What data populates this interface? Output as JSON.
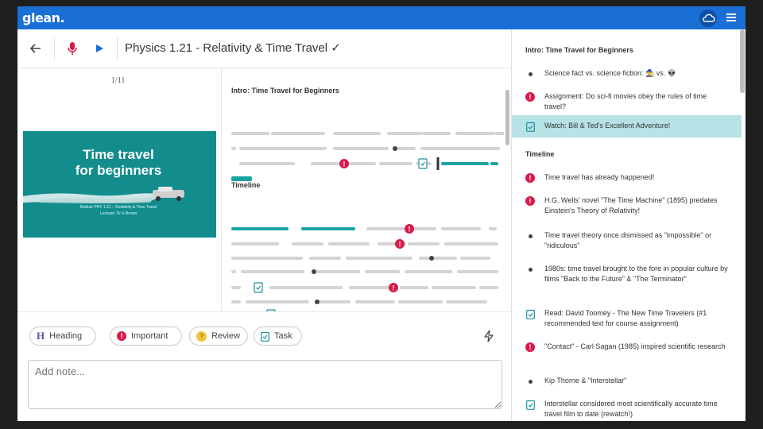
{
  "app": {
    "logo": "glean."
  },
  "header": {
    "title": "Physics 1.21 - Relativity & Time Travel ✓"
  },
  "slide": {
    "page_indicator": "1/11",
    "title_line1": "Time travel",
    "title_line2": "for beginners",
    "subtitle": "Module PHY 1.21 – Relativity & Time Travel",
    "lecturer": "Lecturer: Dr E Brown"
  },
  "outline": {
    "sections": [
      "Intro: Time Travel for Beginners",
      "Timeline"
    ]
  },
  "toolbar": {
    "tags": [
      {
        "label": "Heading",
        "icon": "heading-icon"
      },
      {
        "label": "Important",
        "icon": "important-icon"
      },
      {
        "label": "Review",
        "icon": "review-icon"
      },
      {
        "label": "Task",
        "icon": "task-icon"
      }
    ],
    "note_placeholder": "Add note..."
  },
  "notes": {
    "sections": [
      "Intro: Time Travel for Beginners",
      "Timeline"
    ],
    "intro_items": [
      {
        "type": "bullet",
        "text": "Science fact vs. science fiction: 🧙 vs. 👽"
      },
      {
        "type": "important",
        "text": "Assignment: Do sci-fi movies obey the rules of time travel?"
      },
      {
        "type": "task",
        "text": "Watch: Bill & Ted's Excellent Adventure!"
      }
    ],
    "timeline_items": [
      {
        "type": "important",
        "text": "Time travel has already happened!"
      },
      {
        "type": "important",
        "text": "H.G. Wells' novel \"The Time Machine\" (1895) predates Einstein's Theory of Relativity!"
      },
      {
        "type": "bullet",
        "text": "Time travel theory once dismissed as \"impossible\" or \"ridiculous\""
      },
      {
        "type": "bullet",
        "text": "1980s: time travel brought to the fore in popular culture by films \"Back to the Future\" & \"The Terminator\""
      },
      {
        "type": "task",
        "text": "Read: David Toomey - The New Time Travelers (#1 recommended text for course assignment)"
      },
      {
        "type": "important",
        "text": "\"Contact\" - Carl Sagan (1985) inspired scientific research"
      },
      {
        "type": "bullet",
        "text": "Kip Thorne & \"Interstellar\""
      },
      {
        "type": "task",
        "text": "Interstellar considered most scientifically accurate time travel film to date (rewatch!)"
      }
    ]
  },
  "colors": {
    "brand": "#1a6fd4",
    "accent": "#1aa3a3",
    "important": "#d81b4a",
    "highlight": "#b7e2e6"
  }
}
